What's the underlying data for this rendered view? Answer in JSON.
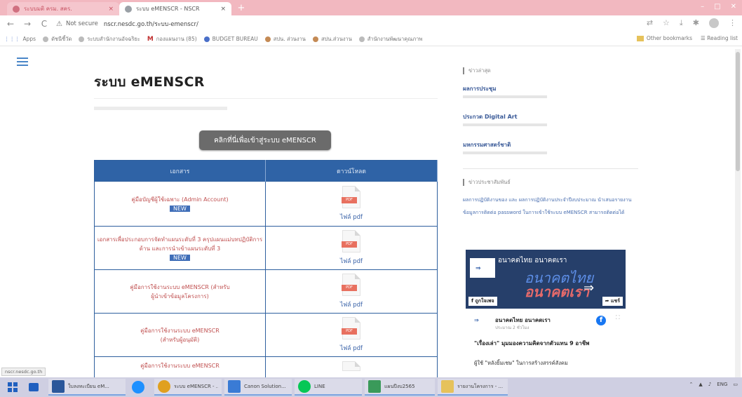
{
  "browser": {
    "tabs": [
      {
        "title": "ระบบมติ ครม. สคร.",
        "close": "×"
      },
      {
        "title": "ระบบ eMENSCR - NSCR",
        "close": "×"
      }
    ],
    "new_tab": "+",
    "nav": {
      "back": "←",
      "forward": "→",
      "reload": "C"
    },
    "address": {
      "warning": "⚠",
      "not_secure": "Not secure",
      "url": "nscr.nesdc.go.th/ระบบ-emenscr/"
    },
    "bookmarks": [
      {
        "label": "Apps",
        "icon": "apps-grid-icon"
      },
      {
        "label": "ดัชนีชี้วัด",
        "icon": "globe-icon"
      },
      {
        "label": "ระบบสำนักงานอัจฉริยะ",
        "icon": "globe-icon"
      },
      {
        "label": "กองแผนงาน (85)",
        "icon": "gmail-icon"
      },
      {
        "label": "BUDGET BUREAU",
        "icon": "globe-icon"
      },
      {
        "label": "สปน. ส่วนงาน",
        "icon": "orange-circle-icon"
      },
      {
        "label": "สปน.ส่วนงาน",
        "icon": "orange-circle-icon"
      },
      {
        "label": "สำนักงานพัฒนาคุณภาพ",
        "icon": "globe-icon"
      }
    ],
    "other_bookmarks": "Other bookmarks",
    "reading_list": "Reading list"
  },
  "page": {
    "title": "ระบบ eMENSCR",
    "enter_button": "คลิกที่นี่เพื่อเข้าสู่ระบบ eMENSCR",
    "table": {
      "headers": [
        "เอกสาร",
        "ดาวน์โหลด"
      ],
      "rows": [
        {
          "doc": "คู่มือบัญชีผู้ใช้เฉพาะ (Admin Account)",
          "badge": "NEW",
          "file": "ไฟล์ pdf"
        },
        {
          "doc": "เอกสารเพื่อประกอบการจัดทำแผนระดับที่ 3 ครุปแผนแม่บทปฏิบัติการด้าน และการนำเข้าแผนระดับที่ 3",
          "badge": "NEW",
          "file": "ไฟล์ pdf"
        },
        {
          "doc": "คู่มือการใช้งานระบบ eMENSCR (สำหรับผู้นำเข้าข้อมูลโครงการ)",
          "badge": "",
          "file": "ไฟล์ pdf"
        },
        {
          "doc": "คู่มือการใช้งานระบบ eMENSCR (สำหรับผู้อนุมัติ)",
          "badge": "",
          "file": "ไฟล์ pdf"
        },
        {
          "doc": "คู่มือการใช้งานระบบ eMENSCR",
          "badge": "",
          "file": ""
        }
      ],
      "pdf_tag": "PDF"
    }
  },
  "sidebar": {
    "section1": "ข่าวล่าสุด",
    "links": [
      "ผลการประชุม",
      "ประกวด Digital Art",
      "มหกรรมศาสตร์ชาติ"
    ],
    "section2": "ข่าวประชาสัมพันธ์",
    "notice1": "ผลการปฏิบัติงานของ และ ผลการปฏิบัติงานประจำปีงบประมาณ นำเสนอรายงาน",
    "notice2": "ข้อมูลการติดต่อ password ในการเข้าใช้ระบบ eMENSCR สามารถติดต่อได้",
    "fb": {
      "page_name": "อนาคตไทย อนาคตเรา",
      "banner_line1": "อนาคตไทย",
      "banner_line2": "อนาคตเรา",
      "like": "ถูกใจเพจ",
      "share": "แชร์",
      "post_author": "อนาคตไทย อนาคตเรา",
      "post_time": "ประมาณ 2 ชั่วโมง",
      "post_title": "\"เรื่องเล่า\" มุมมองความคิดจากตัวแทน 9 อาชีพ",
      "post_sub": "ผู้ใช้ \"หลังยิ้มเชษ\" ในการสร้างสรรค์สังคม"
    }
  },
  "status_link": "nscr.nesdc.go.th",
  "taskbar": {
    "items": [
      {
        "label": "",
        "color": "#1f5fbf"
      },
      {
        "label": "ใบลงทะเบียน eM...",
        "color": "#2b579a"
      },
      {
        "label": "",
        "color": "#1e90ff"
      },
      {
        "label": "ระบบ eMENSCR - ...",
        "color": "#e0a020"
      },
      {
        "label": "Canon Solution...",
        "color": "#3a7bd5"
      },
      {
        "label": "LINE",
        "color": "#06c755"
      },
      {
        "label": "แผนปีงบ2565",
        "color": "#3a9a5a"
      },
      {
        "label": "รายงานโครงการ - ...",
        "color": "#e6c25b"
      }
    ],
    "tray_lang": "ENG"
  }
}
